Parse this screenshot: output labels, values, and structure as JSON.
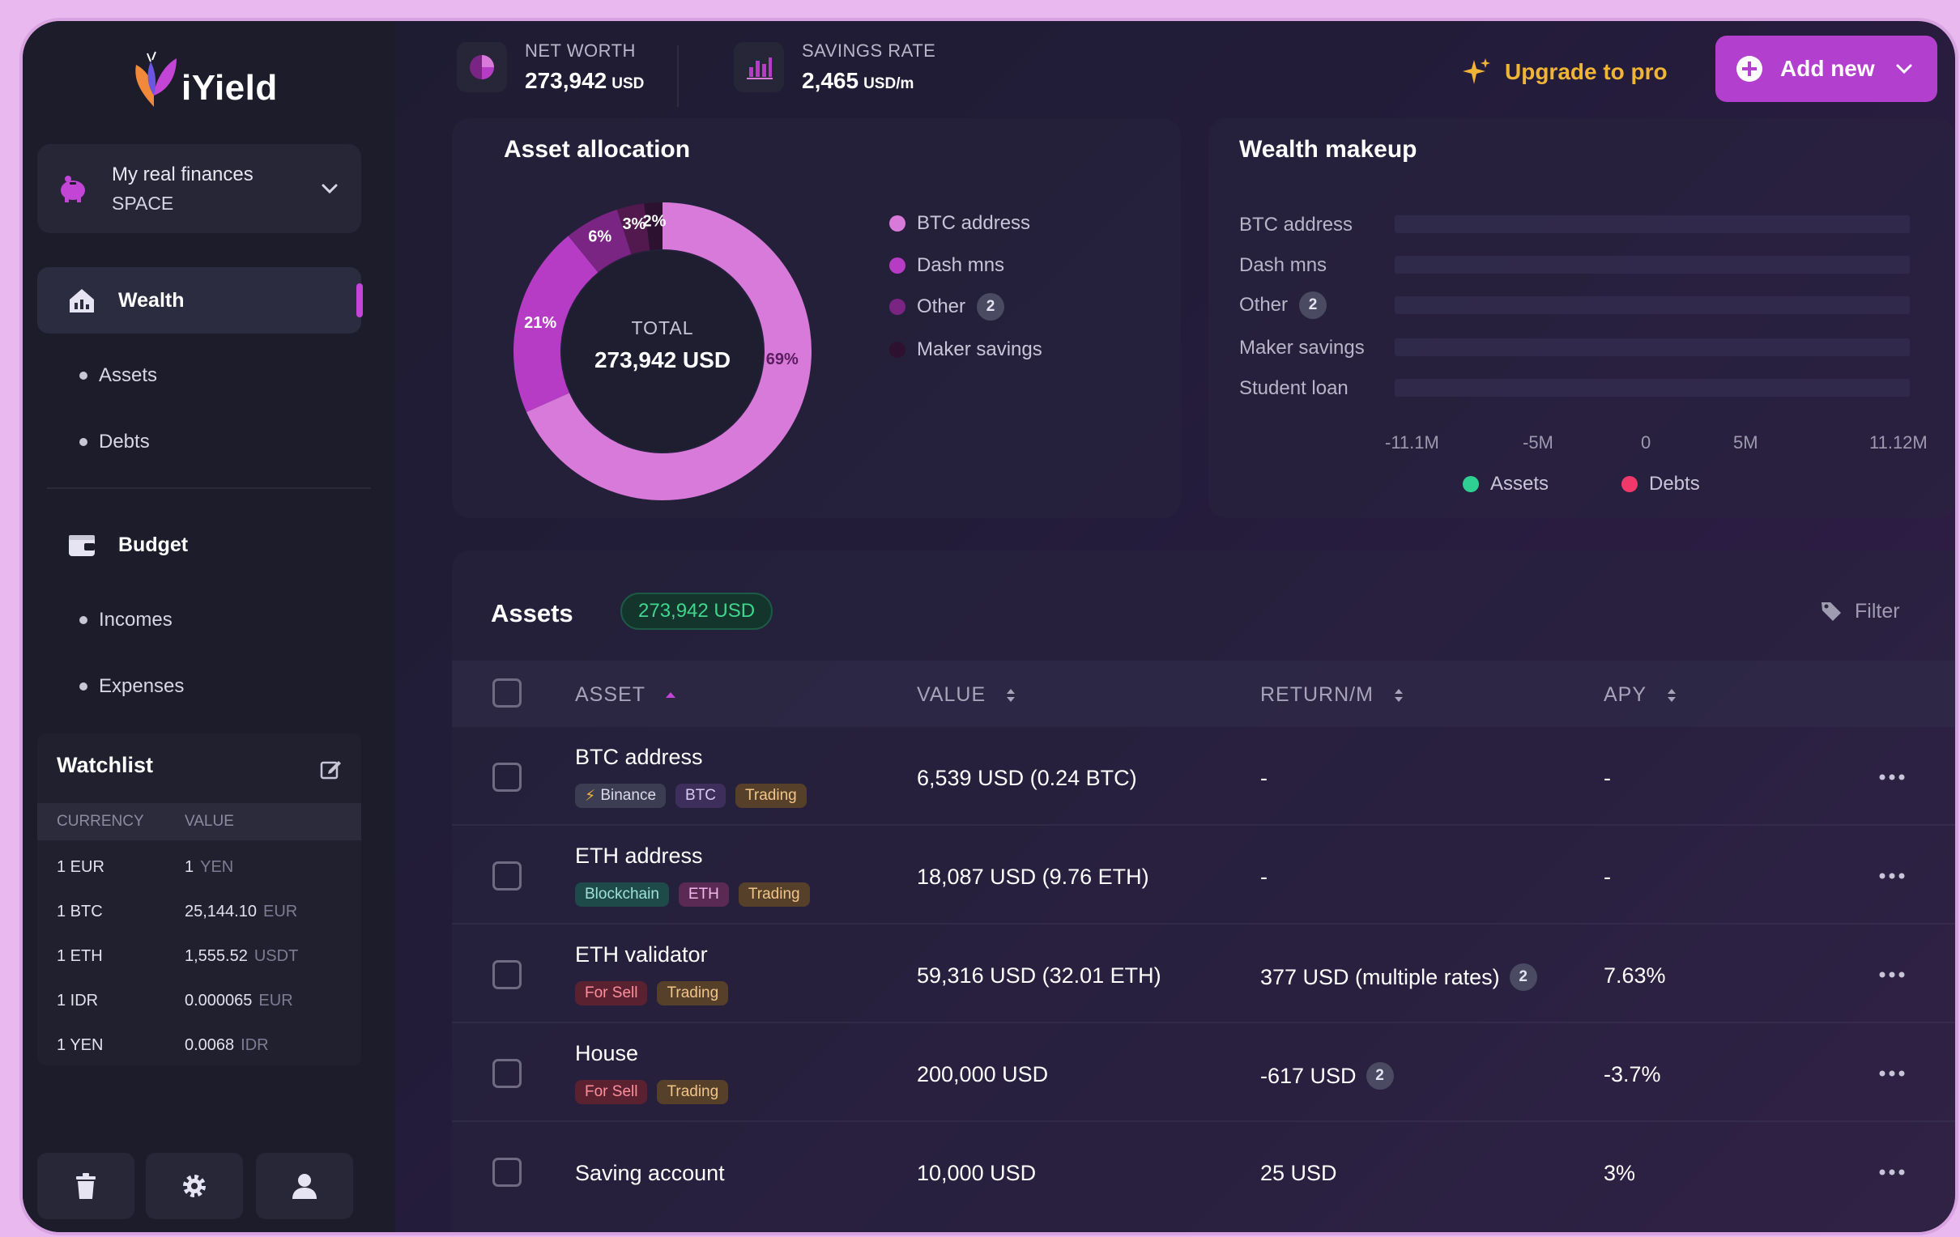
{
  "app": {
    "name": "iYield"
  },
  "space": {
    "name": "My real finances",
    "type": "SPACE"
  },
  "nav": {
    "wealth": "Wealth",
    "assets": "Assets",
    "debts": "Debts",
    "budget": "Budget",
    "incomes": "Incomes",
    "expenses": "Expenses"
  },
  "watchlist": {
    "title": "Watchlist",
    "headers": {
      "currency": "CURRENCY",
      "value": "VALUE"
    },
    "rows": [
      {
        "currency": "1 EUR",
        "value": "1",
        "unit": "YEN"
      },
      {
        "currency": "1 BTC",
        "value": "25,144.10",
        "unit": "EUR"
      },
      {
        "currency": "1 ETH",
        "value": "1,555.52",
        "unit": "USDT"
      },
      {
        "currency": "1 IDR",
        "value": "0.000065",
        "unit": "EUR"
      },
      {
        "currency": "1 YEN",
        "value": "0.0068",
        "unit": "IDR"
      }
    ]
  },
  "header": {
    "net_worth_label": "NET WORTH",
    "net_worth_value": "273,942",
    "net_worth_unit": "USD",
    "savings_rate_label": "SAVINGS RATE",
    "savings_rate_value": "2,465",
    "savings_rate_unit": "USD/m",
    "upgrade": "Upgrade to pro",
    "add_new": "Add new"
  },
  "allocation": {
    "title": "Asset allocation",
    "center_label": "TOTAL",
    "center_value": "273,942 USD",
    "slices": [
      {
        "label": "69%",
        "value": 69,
        "color": "#d77ad9"
      },
      {
        "label": "21%",
        "value": 21,
        "color": "#b63cc6"
      },
      {
        "label": "6%",
        "value": 6,
        "color": "#7a2484"
      },
      {
        "label": "3%",
        "value": 3,
        "color": "#52194f"
      },
      {
        "label": "2%",
        "value": 2,
        "color": "#2c1130"
      }
    ],
    "legend": [
      {
        "label": "BTC address",
        "color": "#d77ad9"
      },
      {
        "label": "Dash mns",
        "color": "#b63cc6"
      },
      {
        "label": "Other",
        "color": "#7a2484",
        "badge": "2"
      },
      {
        "label": "Maker savings",
        "color": "#2c1130"
      }
    ]
  },
  "wealth_makeup": {
    "title": "Wealth makeup",
    "rows": [
      {
        "label": "BTC address"
      },
      {
        "label": "Dash mns"
      },
      {
        "label": "Other",
        "badge": "2"
      },
      {
        "label": "Maker savings"
      },
      {
        "label": "Student loan"
      }
    ],
    "ticks": [
      "-11.1M",
      "-5M",
      "0",
      "5M",
      "11.12M"
    ],
    "legend": [
      {
        "label": "Assets",
        "color": "#2fcf93"
      },
      {
        "label": "Debts",
        "color": "#f0386b"
      }
    ]
  },
  "assets": {
    "title": "Assets",
    "total": "273,942 USD",
    "filter": "Filter",
    "columns": {
      "asset": "ASSET",
      "value": "VALUE",
      "return": "RETURN/M",
      "apy": "APY"
    },
    "rows": [
      {
        "name": "BTC address",
        "tags": [
          {
            "label": "Binance",
            "style": "gray",
            "icon": true
          },
          {
            "label": "BTC",
            "style": "purple"
          },
          {
            "label": "Trading",
            "style": "orange"
          }
        ],
        "value": "6,539 USD (0.24 BTC)",
        "return": "-",
        "return_badge": "",
        "apy": "-"
      },
      {
        "name": "ETH address",
        "tags": [
          {
            "label": "Blockchain",
            "style": "teal"
          },
          {
            "label": "ETH",
            "style": "pink"
          },
          {
            "label": "Trading",
            "style": "orange"
          }
        ],
        "value": "18,087 USD (9.76 ETH)",
        "return": "-",
        "return_badge": "",
        "apy": "-"
      },
      {
        "name": "ETH validator",
        "tags": [
          {
            "label": "For Sell",
            "style": "red"
          },
          {
            "label": "Trading",
            "style": "orange"
          }
        ],
        "value": "59,316 USD (32.01 ETH)",
        "return": "377 USD (multiple rates)",
        "return_badge": "2",
        "apy": "7.63%"
      },
      {
        "name": "House",
        "tags": [
          {
            "label": "For Sell",
            "style": "red"
          },
          {
            "label": "Trading",
            "style": "orange"
          }
        ],
        "value": "200,000 USD",
        "return": "-617 USD",
        "return_badge": "2",
        "apy": "-3.7%"
      },
      {
        "name": "Saving account",
        "tags": [],
        "value": "10,000 USD",
        "return": "25 USD",
        "return_badge": "",
        "apy": "3%"
      }
    ]
  }
}
